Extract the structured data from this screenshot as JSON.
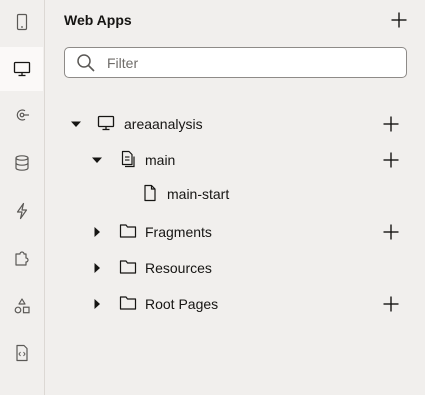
{
  "rail": {
    "items": [
      {
        "name": "mobile",
        "icon": "mobile-device-icon",
        "active": false
      },
      {
        "name": "web",
        "icon": "desktop-monitor-icon",
        "active": true
      },
      {
        "name": "services",
        "icon": "service-connection-icon",
        "active": false
      },
      {
        "name": "data",
        "icon": "database-icon",
        "active": false
      },
      {
        "name": "processes",
        "icon": "lightning-icon",
        "active": false
      },
      {
        "name": "components",
        "icon": "puzzle-icon",
        "active": false
      },
      {
        "name": "resources",
        "icon": "shapes-icon",
        "active": false
      },
      {
        "name": "source",
        "icon": "code-file-icon",
        "active": false
      }
    ]
  },
  "panel": {
    "title": "Web Apps",
    "filter": {
      "placeholder": "Filter",
      "value": ""
    }
  },
  "tree": [
    {
      "label": "areaanalysis",
      "icon": "desktop-monitor-icon",
      "expanded": true
    },
    {
      "label": "main",
      "icon": "flow-document-icon",
      "expanded": true
    },
    {
      "label": "main-start",
      "icon": "page-file-icon"
    },
    {
      "label": "Fragments",
      "icon": "folder-icon",
      "expanded": false
    },
    {
      "label": "Resources",
      "icon": "folder-icon",
      "expanded": false
    },
    {
      "label": "Root Pages",
      "icon": "folder-icon",
      "expanded": false
    }
  ]
}
